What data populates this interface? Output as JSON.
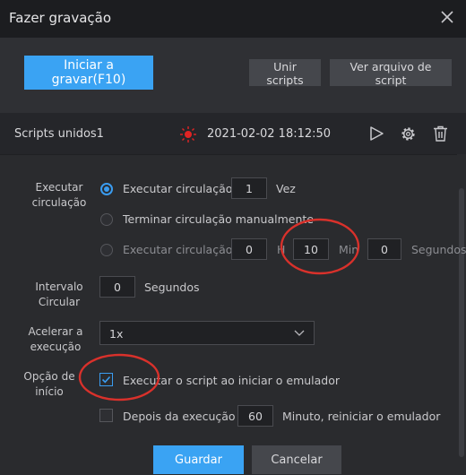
{
  "window": {
    "title": "Fazer gravação"
  },
  "toolbar": {
    "start_label": "Iniciar a gravar(F10)",
    "merge_label": "Unir scripts",
    "view_label": "Ver arquivo de script"
  },
  "script_row": {
    "name": "Scripts unidos1",
    "datetime": "2021-02-02 18:12:50"
  },
  "execute_loop": {
    "label": "Executar circulação",
    "opt1": {
      "text": "Executar circulação",
      "value": "1",
      "unit": "Vez",
      "selected": true
    },
    "opt2": {
      "text": "Terminar circulação manualmente",
      "selected": false
    },
    "opt3": {
      "text": "Executar circulação",
      "hours": "0",
      "hours_unit": "H",
      "minutes": "10",
      "minutes_unit": "Min",
      "seconds": "0",
      "seconds_unit": "Segundos",
      "selected": false
    }
  },
  "interval": {
    "label": "Intervalo Circular",
    "value": "0",
    "unit": "Segundos"
  },
  "speed": {
    "label": "Acelerar a execução",
    "value": "1x"
  },
  "start_options": {
    "label": "Opção de início",
    "run_on_start": {
      "text": "Executar o script ao iniciar o emulador",
      "checked": true
    },
    "restart_after": {
      "text": "Depois da execução",
      "value": "60",
      "suffix": "Minuto, reiniciar o emulador",
      "checked": false
    }
  },
  "footer": {
    "save_label": "Guardar",
    "cancel_label": "Cancelar"
  },
  "colors": {
    "accent": "#3aa3f3",
    "annotation": "#d9312b",
    "record": "#e02424"
  }
}
